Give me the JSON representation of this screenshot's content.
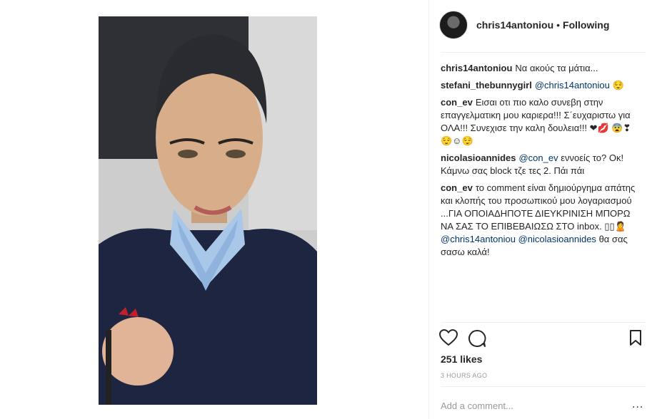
{
  "post": {
    "username": "chris14antoniou",
    "separator": "•",
    "follow_status": "Following",
    "caption": "Να ακούς τα μάτια...",
    "likes": "251 likes",
    "timestamp": "3 HOURS AGO",
    "add_comment_placeholder": "Add a comment...",
    "more_options": "..."
  },
  "comments": [
    {
      "user": "stefani_thebunnygirl",
      "mention": "@chris14antoniou",
      "text": "😌"
    },
    {
      "user": "con_ev",
      "text": "Εισαι οτι πιο καλο συνεβη στην επαγγελματικη μου καριερα!!! Σ΄ευχαριστω για ΟΛΑ!!! Συνεχισε την καλη δουλεια!!! ❤💋 😨❣😌☺😌"
    },
    {
      "user": "nicolasioannides",
      "mention": "@con_ev",
      "text": "εννοείς το? Οκ! Κάμνω σας block τζε τες 2. Πάι πάι"
    },
    {
      "user": "con_ev",
      "text": "το comment είναι δημιούργημα απάτης και κλοπής του προσωπικού μου λογαριασμού ...ΓΙΑ ΟΠΟΙΑΔΗΠΟΤΕ ΔΙΕΥΚΡΙΝΙΣΗ ΜΠΟΡΩ ΝΑ ΣΑΣ ΤΟ ΕΠΙΒΕΒΑΙΩΣΩ ΣΤΟ inbox. ▯▯🙎",
      "mention1": "@chris14antoniou",
      "mention2": "@nicolasioannides",
      "tail": "θα σας σασω καλά!"
    }
  ],
  "icons": {
    "like": "heart-icon",
    "comment": "comment-icon",
    "save": "bookmark-icon"
  },
  "colors": {
    "mention": "#003569",
    "muted": "#999999",
    "text": "#262626"
  }
}
